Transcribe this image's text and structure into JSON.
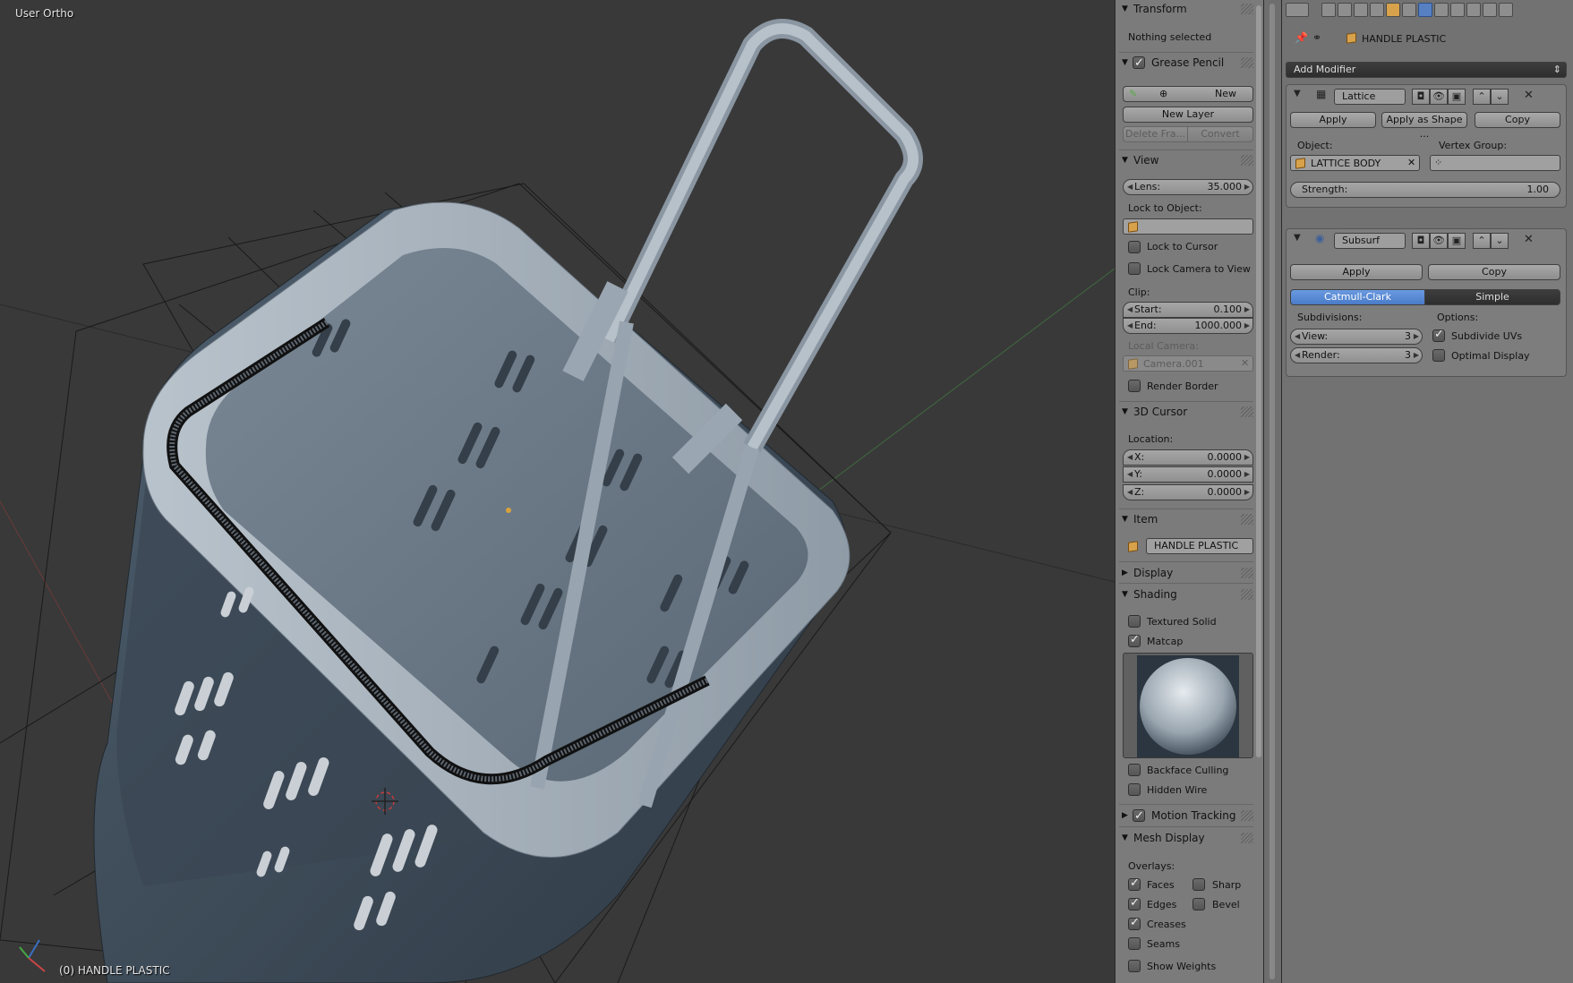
{
  "viewport": {
    "view_name": "User Ortho",
    "active_object": "(0) HANDLE PLASTIC"
  },
  "npanel": {
    "transform": {
      "title": "Transform",
      "status": "Nothing selected"
    },
    "grease_pencil": {
      "title": "Grease Pencil",
      "new": "New",
      "new_layer": "New Layer",
      "delete_frame": "Delete Fra...",
      "convert": "Convert"
    },
    "view": {
      "title": "View",
      "lens_label": "Lens:",
      "lens_value": "35.000",
      "lock_to_object": "Lock to Object:",
      "lock_to_cursor": "Lock to Cursor",
      "lock_camera": "Lock Camera to View",
      "clip": "Clip:",
      "start_label": "Start:",
      "start_value": "0.100",
      "end_label": "End:",
      "end_value": "1000.000",
      "local_camera": "Local Camera:",
      "camera": "Camera.001",
      "render_border": "Render Border"
    },
    "cursor": {
      "title": "3D Cursor",
      "location": "Location:",
      "x_label": "X:",
      "x_value": "0.0000",
      "y_label": "Y:",
      "y_value": "0.0000",
      "z_label": "Z:",
      "z_value": "0.0000"
    },
    "item": {
      "title": "Item",
      "name": "HANDLE PLASTIC"
    },
    "display": {
      "title": "Display"
    },
    "shading": {
      "title": "Shading",
      "textured_solid": "Textured Solid",
      "matcap": "Matcap",
      "backface": "Backface Culling",
      "hidden_wire": "Hidden Wire"
    },
    "motion_tracking": {
      "title": "Motion Tracking"
    },
    "mesh_display": {
      "title": "Mesh Display",
      "overlays": "Overlays:",
      "faces": "Faces",
      "sharp": "Sharp",
      "edges": "Edges",
      "bevel": "Bevel",
      "creases": "Creases",
      "seams": "Seams",
      "show_weights": "Show Weights"
    }
  },
  "properties": {
    "object_name": "HANDLE PLASTIC",
    "add_modifier": "Add Modifier",
    "lattice": {
      "name": "Lattice",
      "apply": "Apply",
      "apply_shape": "Apply as Shape ...",
      "copy": "Copy",
      "object_label": "Object:",
      "object_value": "LATTICE BODY",
      "vgroup_label": "Vertex Group:",
      "strength_label": "Strength:",
      "strength_value": "1.00"
    },
    "subsurf": {
      "name": "Subsurf",
      "apply": "Apply",
      "copy": "Copy",
      "catmull": "Catmull-Clark",
      "simple": "Simple",
      "subdivisions": "Subdivisions:",
      "options": "Options:",
      "view_label": "View:",
      "view_value": "3",
      "render_label": "Render:",
      "render_value": "3",
      "subdivide_uvs": "Subdivide UVs",
      "optimal_display": "Optimal Display"
    }
  },
  "colors": {
    "viewport_bg": "#393939",
    "panel_bg": "#7b7b7b",
    "accent": "#5680c2",
    "object_icon": "#d7a24b"
  },
  "icons": [
    "pencil-icon",
    "plus-icon",
    "object-icon",
    "camera-icon",
    "eye-icon",
    "lattice-icon",
    "subsurf-icon",
    "pin-icon",
    "wrench-icon",
    "close-icon"
  ]
}
